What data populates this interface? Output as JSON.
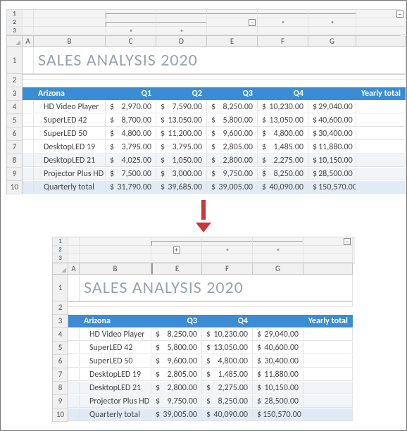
{
  "title": "SALES ANALYSIS 2020",
  "region": "Arizona",
  "col_labels_full": [
    "Q1",
    "Q2",
    "Q3",
    "Q4",
    "Yearly total"
  ],
  "col_labels_collapsed": [
    "Q3",
    "Q4",
    "Yearly total"
  ],
  "col_letters_full": [
    "A",
    "B",
    "C",
    "D",
    "E",
    "F",
    "G"
  ],
  "col_letters_collapsed": [
    "A",
    "B",
    "E",
    "F",
    "G"
  ],
  "row_nums": [
    "1",
    "2",
    "3",
    "4",
    "5",
    "6",
    "7",
    "8",
    "9",
    "10"
  ],
  "outline_levels": [
    "1",
    "2",
    "3"
  ],
  "currency": "$",
  "minus": "–",
  "plus": "+",
  "products": [
    {
      "name": "HD Video Player",
      "q1": "2,970.00",
      "q2": "7,590.00",
      "q3": "8,250.00",
      "q4": "10,230.00",
      "yt": "29,040.00"
    },
    {
      "name": "SuperLED 42",
      "q1": "8,700.00",
      "q2": "13,050.00",
      "q3": "5,800.00",
      "q4": "13,050.00",
      "yt": "40,600.00"
    },
    {
      "name": "SuperLED 50",
      "q1": "4,800.00",
      "q2": "11,200.00",
      "q3": "9,600.00",
      "q4": "4,800.00",
      "yt": "30,400.00"
    },
    {
      "name": "DesktopLED 19",
      "q1": "3,795.00",
      "q2": "3,795.00",
      "q3": "2,805.00",
      "q4": "1,485.00",
      "yt": "11,880.00"
    },
    {
      "name": "DesktopLED 21",
      "q1": "4,025.00",
      "q2": "1,050.00",
      "q3": "2,800.00",
      "q4": "2,275.00",
      "yt": "10,150.00"
    },
    {
      "name": "Projector Plus HD",
      "q1": "7,500.00",
      "q2": "3,000.00",
      "q3": "9,750.00",
      "q4": "8,250.00",
      "yt": "28,500.00"
    }
  ],
  "total_label": "Quarterly total",
  "totals": {
    "q1": "31,790.00",
    "q2": "39,685.00",
    "q3": "39,005.00",
    "q4": "40,090.00",
    "yt": "150,570.00"
  }
}
